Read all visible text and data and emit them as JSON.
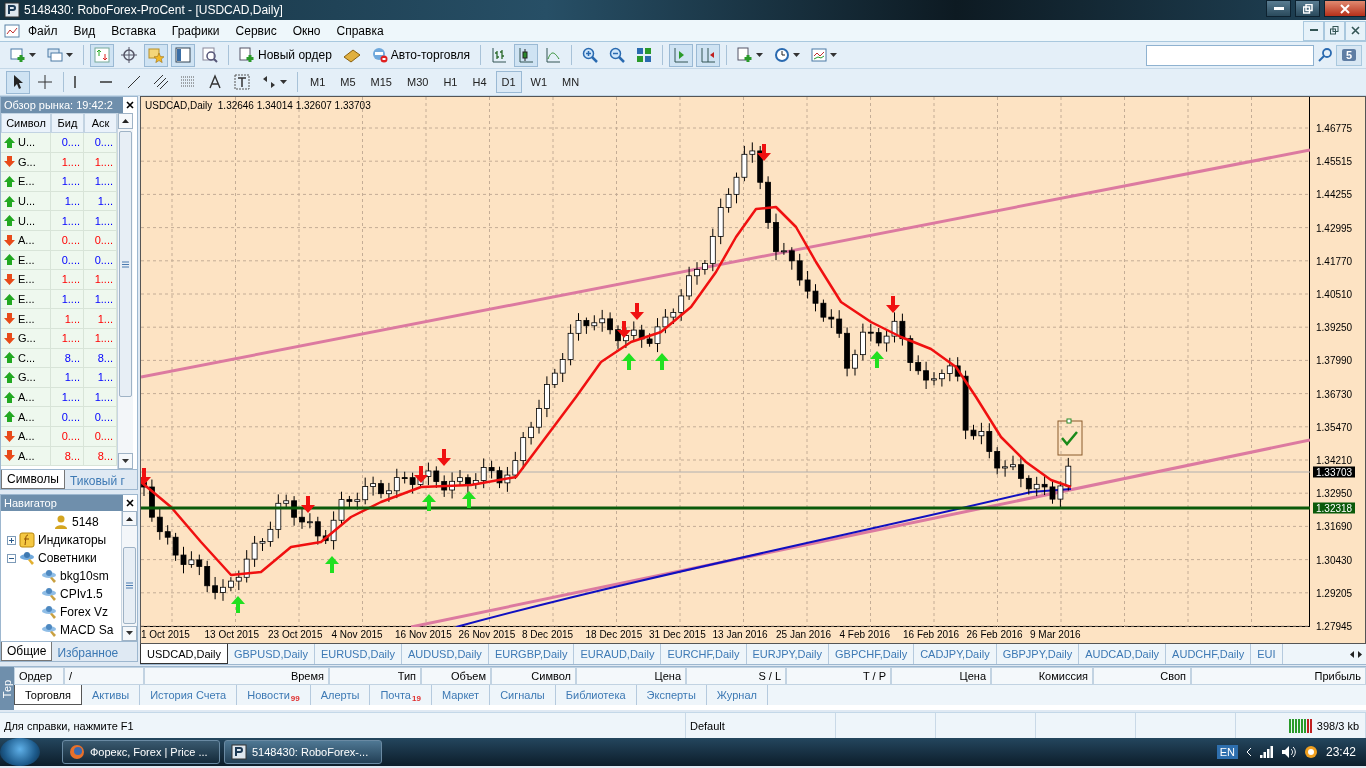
{
  "window": {
    "title": "5148430: RoboForex-ProCent - [USDCAD,Daily]"
  },
  "menu": [
    "Файл",
    "Вид",
    "Вставка",
    "Графики",
    "Сервис",
    "Окно",
    "Справка"
  ],
  "toolbar": {
    "new_order": "Новый ордер",
    "auto_trading": "Авто-торговля",
    "notifications": "5"
  },
  "timeframes": [
    {
      "label": "M1",
      "selected": false
    },
    {
      "label": "M5",
      "selected": false
    },
    {
      "label": "M15",
      "selected": false
    },
    {
      "label": "M30",
      "selected": false
    },
    {
      "label": "H1",
      "selected": false
    },
    {
      "label": "H4",
      "selected": false
    },
    {
      "label": "D1",
      "selected": true
    },
    {
      "label": "W1",
      "selected": false
    },
    {
      "label": "MN",
      "selected": false
    }
  ],
  "market_watch": {
    "title": "Обзор рынка: 19:42:2",
    "columns": [
      "Символ",
      "Бид",
      "Аск"
    ],
    "rows": [
      {
        "symbol": "U...",
        "bid": "0....",
        "ask": "0....",
        "kind": "up"
      },
      {
        "symbol": "G...",
        "bid": "1....",
        "ask": "1....",
        "kind": "down"
      },
      {
        "symbol": "E...",
        "bid": "1....",
        "ask": "1....",
        "kind": "up"
      },
      {
        "symbol": "U...",
        "bid": "1...",
        "ask": "1...",
        "kind": "up"
      },
      {
        "symbol": "U...",
        "bid": "1....",
        "ask": "1....",
        "kind": "up"
      },
      {
        "symbol": "A...",
        "bid": "0....",
        "ask": "0....",
        "kind": "down"
      },
      {
        "symbol": "E...",
        "bid": "0....",
        "ask": "0....",
        "kind": "up"
      },
      {
        "symbol": "E...",
        "bid": "1....",
        "ask": "1....",
        "kind": "down"
      },
      {
        "symbol": "E...",
        "bid": "1....",
        "ask": "1....",
        "kind": "up"
      },
      {
        "symbol": "E...",
        "bid": "1...",
        "ask": "1...",
        "kind": "down"
      },
      {
        "symbol": "G...",
        "bid": "1....",
        "ask": "1....",
        "kind": "down"
      },
      {
        "symbol": "C...",
        "bid": "8...",
        "ask": "8...",
        "kind": "up"
      },
      {
        "symbol": "G...",
        "bid": "1...",
        "ask": "1...",
        "kind": "up"
      },
      {
        "symbol": "A...",
        "bid": "1....",
        "ask": "1....",
        "kind": "up"
      },
      {
        "symbol": "A...",
        "bid": "0....",
        "ask": "0....",
        "kind": "up"
      },
      {
        "symbol": "A...",
        "bid": "0....",
        "ask": "0....",
        "kind": "down"
      },
      {
        "symbol": "A...",
        "bid": "8...",
        "ask": "8...",
        "kind": "down"
      }
    ],
    "tabs": [
      {
        "label": "Символы",
        "selected": true
      },
      {
        "label": "Тиковый г",
        "selected": false
      }
    ]
  },
  "navigator": {
    "title": "Навигатор",
    "tree": [
      {
        "label": "5148",
        "kind": "account"
      },
      {
        "label": "Индикаторы",
        "kind": "indicators",
        "expanded": false
      },
      {
        "label": "Советники",
        "kind": "experts",
        "expanded": true,
        "children": [
          {
            "label": "bkg10sm",
            "kind": "expert"
          },
          {
            "label": "CPIv1.5",
            "kind": "expert"
          },
          {
            "label": "Forex Vz",
            "kind": "expert"
          },
          {
            "label": "MACD Sa",
            "kind": "expert"
          }
        ]
      }
    ],
    "tabs": [
      {
        "label": "Общие",
        "selected": true
      },
      {
        "label": "Избранное",
        "selected": false
      }
    ]
  },
  "chart": {
    "header": "USDCAD,Daily  1.32646 1.34014 1.32607 1.33703",
    "price_labels": [
      "1.46775",
      "1.45515",
      "1.44255",
      "1.42995",
      "1.41770",
      "1.40510",
      "1.39250",
      "1.37990",
      "1.36730",
      "1.35470",
      "1.34210",
      "1.32950",
      "1.31690",
      "1.30430",
      "1.29205",
      "1.27945"
    ],
    "current_price": "1.33703",
    "line_price": "1.32318",
    "dates": [
      "1 Oct 2015",
      "13 Oct 2015",
      "23 Oct 2015",
      "4 Nov 2015",
      "16 Nov 2015",
      "26 Nov 2015",
      "8 Dec 2015",
      "18 Dec 2015",
      "31 Dec 2015",
      "13 Jan 2016",
      "25 Jan 2016",
      "4 Feb 2016",
      "16 Feb 2016",
      "26 Feb 2016",
      "9 Mar 2016"
    ]
  },
  "chart_tabs": [
    {
      "label": "USDCAD,Daily",
      "selected": true
    },
    {
      "label": "GBPUSD,Daily",
      "selected": false
    },
    {
      "label": "EURUSD,Daily",
      "selected": false
    },
    {
      "label": "AUDUSD,Daily",
      "selected": false
    },
    {
      "label": "EURGBP,Daily",
      "selected": false
    },
    {
      "label": "EURAUD,Daily",
      "selected": false
    },
    {
      "label": "EURCHF,Daily",
      "selected": false
    },
    {
      "label": "EURJPY,Daily",
      "selected": false
    },
    {
      "label": "GBPCHF,Daily",
      "selected": false
    },
    {
      "label": "CADJPY,Daily",
      "selected": false
    },
    {
      "label": "GBPJPY,Daily",
      "selected": false
    },
    {
      "label": "AUDCAD,Daily",
      "selected": false
    },
    {
      "label": "AUDCHF,Daily",
      "selected": false
    },
    {
      "label": "EUI",
      "selected": false
    }
  ],
  "terminal": {
    "side_label": "Тер",
    "columns": [
      "Ордер",
      "/",
      "Время",
      "Тип",
      "Объем",
      "Символ",
      "Цена",
      "S / L",
      "T / P",
      "Цена",
      "Комиссия",
      "Своп",
      "Прибыль"
    ],
    "tabs": [
      {
        "label": "Торговля",
        "selected": true
      },
      {
        "label": "Активы",
        "selected": false
      },
      {
        "label": "История Счета",
        "selected": false
      },
      {
        "label": "Новости",
        "selected": false,
        "badge": "99"
      },
      {
        "label": "Алерты",
        "selected": false
      },
      {
        "label": "Почта",
        "selected": false,
        "badge": "19"
      },
      {
        "label": "Маркет",
        "selected": false
      },
      {
        "label": "Сигналы",
        "selected": false
      },
      {
        "label": "Библиотека",
        "selected": false
      },
      {
        "label": "Эксперты",
        "selected": false
      },
      {
        "label": "Журнал",
        "selected": false
      }
    ]
  },
  "status_bar": {
    "help": "Для справки, нажмите F1",
    "profile": "Default",
    "traffic": "398/3 kb"
  },
  "taskbar": {
    "items": [
      {
        "label": "Форекс, Forex | Price ...",
        "kind": "browser",
        "selected": false
      },
      {
        "label": "5148430: RoboForex-...",
        "kind": "terminal",
        "selected": true
      }
    ],
    "language": "EN",
    "time": "23:42"
  }
}
